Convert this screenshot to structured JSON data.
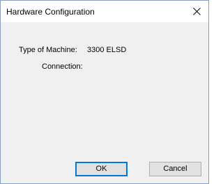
{
  "window": {
    "title": "Hardware Configuration",
    "close_icon": "close-icon"
  },
  "fields": {
    "machine_type_label": "Type of Machine:",
    "machine_type_value": "3300 ELSD",
    "connection_label": "Connection:"
  },
  "buttons": {
    "ok_label": "OK",
    "cancel_label": "Cancel"
  },
  "colors": {
    "window_border": "#8a9fc0",
    "dialog_background": "#f0f0f0",
    "button_background": "#e1e1e1",
    "default_button_accent": "#0078d7"
  }
}
